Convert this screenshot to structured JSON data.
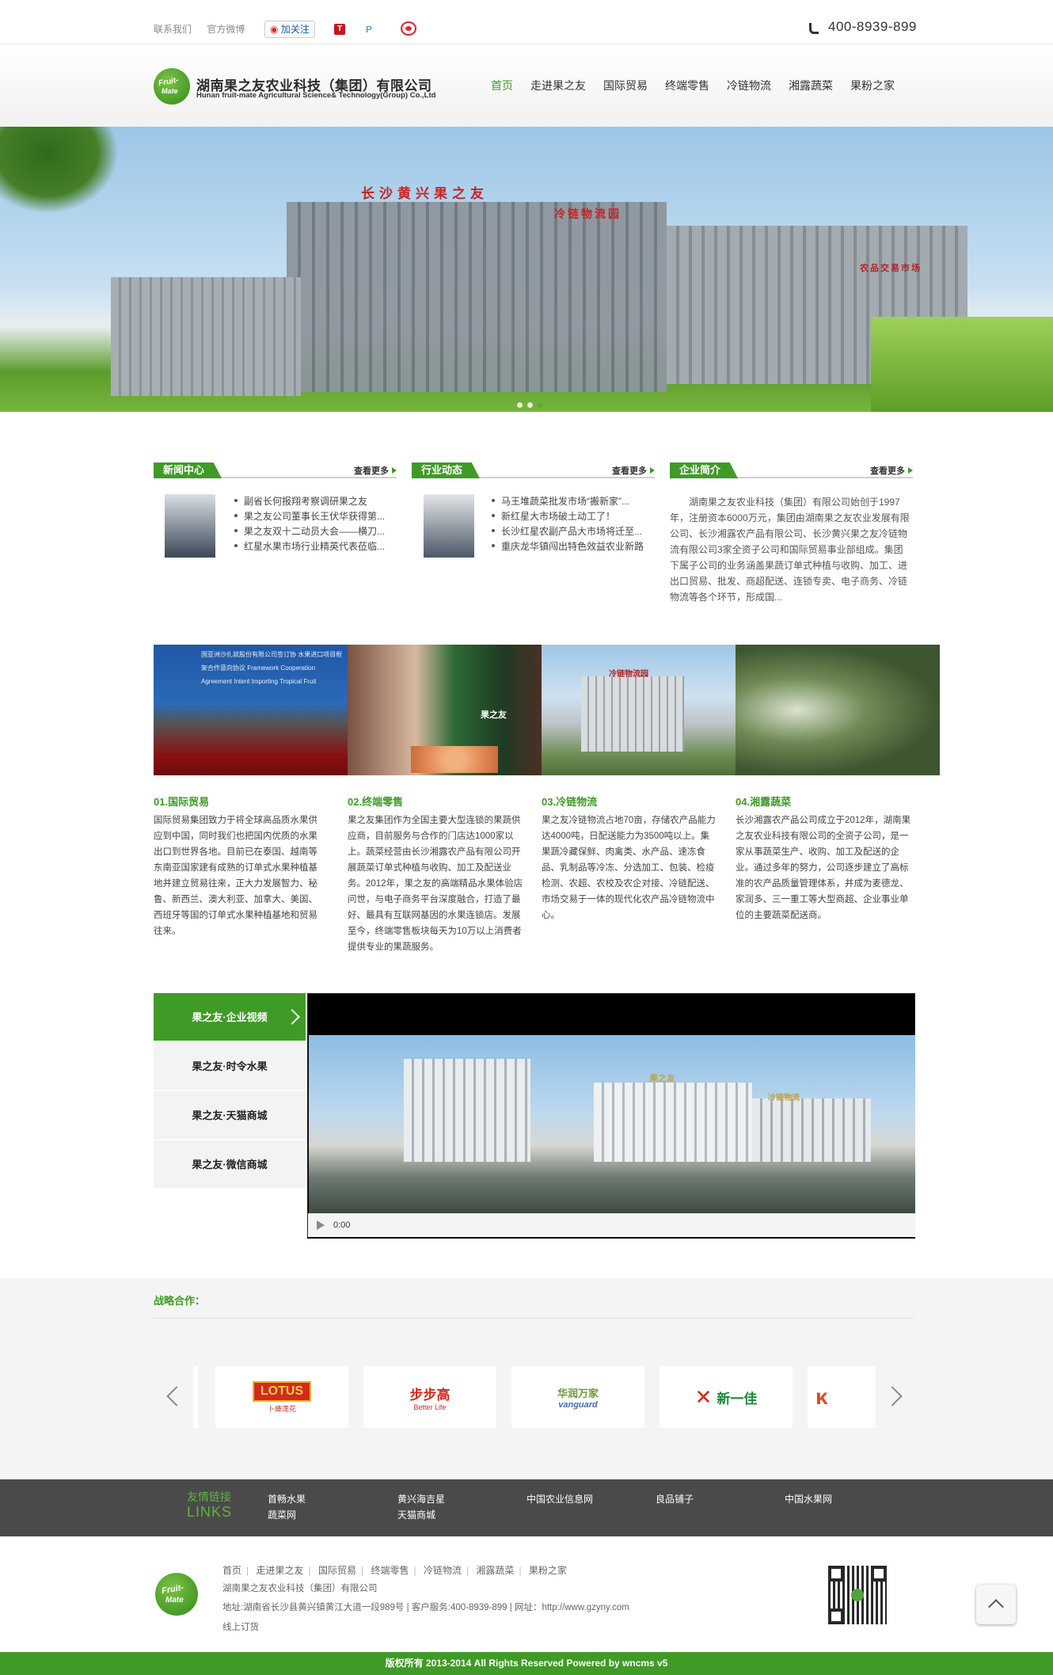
{
  "topbar": {
    "contact": "联系我们",
    "weibo": "官方微博",
    "follow": "加关注",
    "phone": "400-8939-899"
  },
  "header": {
    "title": "湖南果之友农业科技（集团）有限公司",
    "subtitle": "Hunan fruit-mate Agricultural Science& Technology(Group) Co.,Ltd"
  },
  "nav": [
    "首页",
    "走进果之友",
    "国际贸易",
    "终端零售",
    "冷链物流",
    "湘露蔬菜",
    "果粉之家"
  ],
  "banner": {
    "sign1": "长沙黄兴果之友",
    "sign2": "冷链物流园",
    "sign3": "农品交易市场"
  },
  "news": {
    "title": "新闻中心",
    "more": "查看更多",
    "items": [
      "副省长何报翔考察调研果之友",
      "果之友公司董事长王伏华获得第...",
      "果之友双十二动员大会——横刀...",
      "红星水果市场行业精英代表莅临..."
    ]
  },
  "industry": {
    "title": "行业动态",
    "more": "查看更多",
    "items": [
      "马王堆蔬菜批发市场“搬新家”...",
      "新红星大市场破土动工了！",
      "长沙红星农副产品大市场将迁至...",
      "重庆龙华镇闯出特色效益农业新路"
    ]
  },
  "about": {
    "title": "企业简介",
    "more": "查看更多",
    "text": "湖南果之友农业科技（集团）有限公司始创于1997年，注册资本6000万元，集团由湖南果之友农业发展有限公司、长沙湘露农产品有限公司、长沙黄兴果之友冷链物流有限公司3家全资子公司和国际贸易事业部组成。集团下属子公司的业务涵盖果蔬订单式种植与收购、加工、进出口贸易、批发、商超配送、连锁专卖、电子商务、冷链物流等各个环节，形成国..."
  },
  "features": [
    {
      "title": "01.国际贸易",
      "text": "国际贸易集团致力于将全球高品质水果供应到中国，同时我们也把国内优质的水果出口到世界各地。目前已在泰国、越南等东南亚国家建有成熟的订单式水果种植基地并建立贸易往来，正大力发展智力、秘鲁、新西兰、澳大利亚、加拿大、美国、西班牙等国的订单式水果种植基地和贸易往来。"
    },
    {
      "title": "02.终端零售",
      "text": "果之友集团作为全国主要大型连锁的果蔬供应商，目前服务与合作的门店达1000家以上。蔬菜经营由长沙湘露农产品有限公司开展蔬菜订单式种植与收购、加工及配送业务。2012年，果之友的高端精品水果体验店问世，与电子商务平台深度融合，打造了最好、最具有互联网基因的水果连锁店。发展至今，终端零售板块每天为10万以上消费者提供专业的果蔬服务。"
    },
    {
      "title": "03.冷链物流",
      "text": "果之友冷链物流占地70亩，存储农产品能力达4000吨，日配送能力为3500吨以上。集果蔬冷藏保鲜、肉禽类、水产品、速冻食品、乳制品等冷冻、分选加工、包装、检疫检测、农超、农校及农企对接、冷链配送、市场交易于一体的现代化农产品冷链物流中心。"
    },
    {
      "title": "04.湘露蔬菜",
      "text": "长沙湘露农产品公司成立于2012年，湖南果之友农业科技有限公司的全资子公司，是一家从事蔬菜生产、收购、加工及配送的企业。通过多年的努力，公司逐步建立了高标准的农产品质量管理体系，并成为麦德龙、家润多、三一重工等大型商超、企业事业单位的主要蔬菜配送商。"
    }
  ],
  "feature_photos": {
    "sign_banner": "国亚洲沙扎就股份有限公司签订协 水果进口项目框架合作意向协议 Framework Cooperation Agreement Intent Importing Tropical Fruit",
    "apron": "果之友",
    "building": "冷链物流园"
  },
  "video": {
    "tabs": [
      "果之友·企业视频",
      "果之友·时令水果",
      "果之友·天猫商城",
      "果之友·微信商城"
    ],
    "time": "0:00",
    "sign1": "果之友",
    "sign2": "冷链物流"
  },
  "partners": {
    "title": "战略合作：",
    "logos": [
      "LOTUS",
      "步步高",
      "华润万家",
      "新一佳"
    ],
    "logo_sub": [
      "卜蜂莲花",
      "Better Life",
      "vanguard",
      ""
    ]
  },
  "links": {
    "title": "友情链接",
    "title_en": "LINKS",
    "items": [
      "首畅水果",
      "黄兴海吉星",
      "中国农业信息网",
      "良品铺子",
      "中国水果网",
      "蔬菜网",
      "天猫商城"
    ]
  },
  "footer": {
    "nav": [
      "首页",
      "走进果之友",
      "国际贸易",
      "终端零售",
      "冷链物流",
      "湘露蔬菜",
      "果粉之家"
    ],
    "company": "湖南果之友农业科技（集团）有限公司",
    "address": "地址:湖南省长沙县黄兴镇黄江大道一段989号 | 客户服务:400-8939-899 | 网址：http://www.gzyny.com",
    "order": "线上订货",
    "copyright": "版权所有 2013-2014 All Rights Reserved Powered by wncms v5"
  },
  "colors": {
    "brand_green": "#3f9b26",
    "link_bar": "#4a4a4a"
  }
}
